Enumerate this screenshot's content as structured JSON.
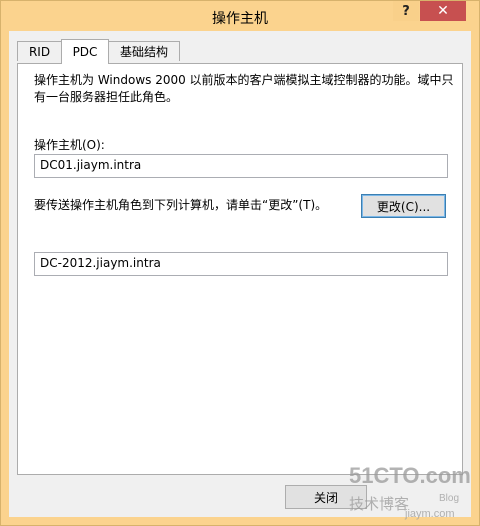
{
  "window": {
    "title": "操作主机",
    "help_glyph": "?",
    "close_glyph": "✕"
  },
  "tabs": [
    {
      "label": "RID",
      "active": false
    },
    {
      "label": "PDC",
      "active": true
    },
    {
      "label": "基础结构",
      "active": false
    }
  ],
  "pdc": {
    "description": "操作主机为 Windows 2000 以前版本的客户端模拟主域控制器的功能。域中只有一台服务器担任此角色。",
    "master_label": "操作主机(O):",
    "master_value": "DC01.jiaym.intra",
    "transfer_text": "要传送操作主机角色到下列计算机，请单击“更改”(T)。",
    "change_button": "更改(C)...",
    "target_value": "DC-2012.jiaym.intra"
  },
  "footer": {
    "close_button": "关闭"
  },
  "watermark": {
    "line1": "51CTO.com",
    "line2": "技术博客",
    "line3": "Blog",
    "line4": "jiaym.com"
  },
  "colors": {
    "frame": "#fbd38e",
    "close_button": "#c75050",
    "dialog_bg": "#f0f0f0",
    "button_focus_border": "#3c7fb1"
  }
}
